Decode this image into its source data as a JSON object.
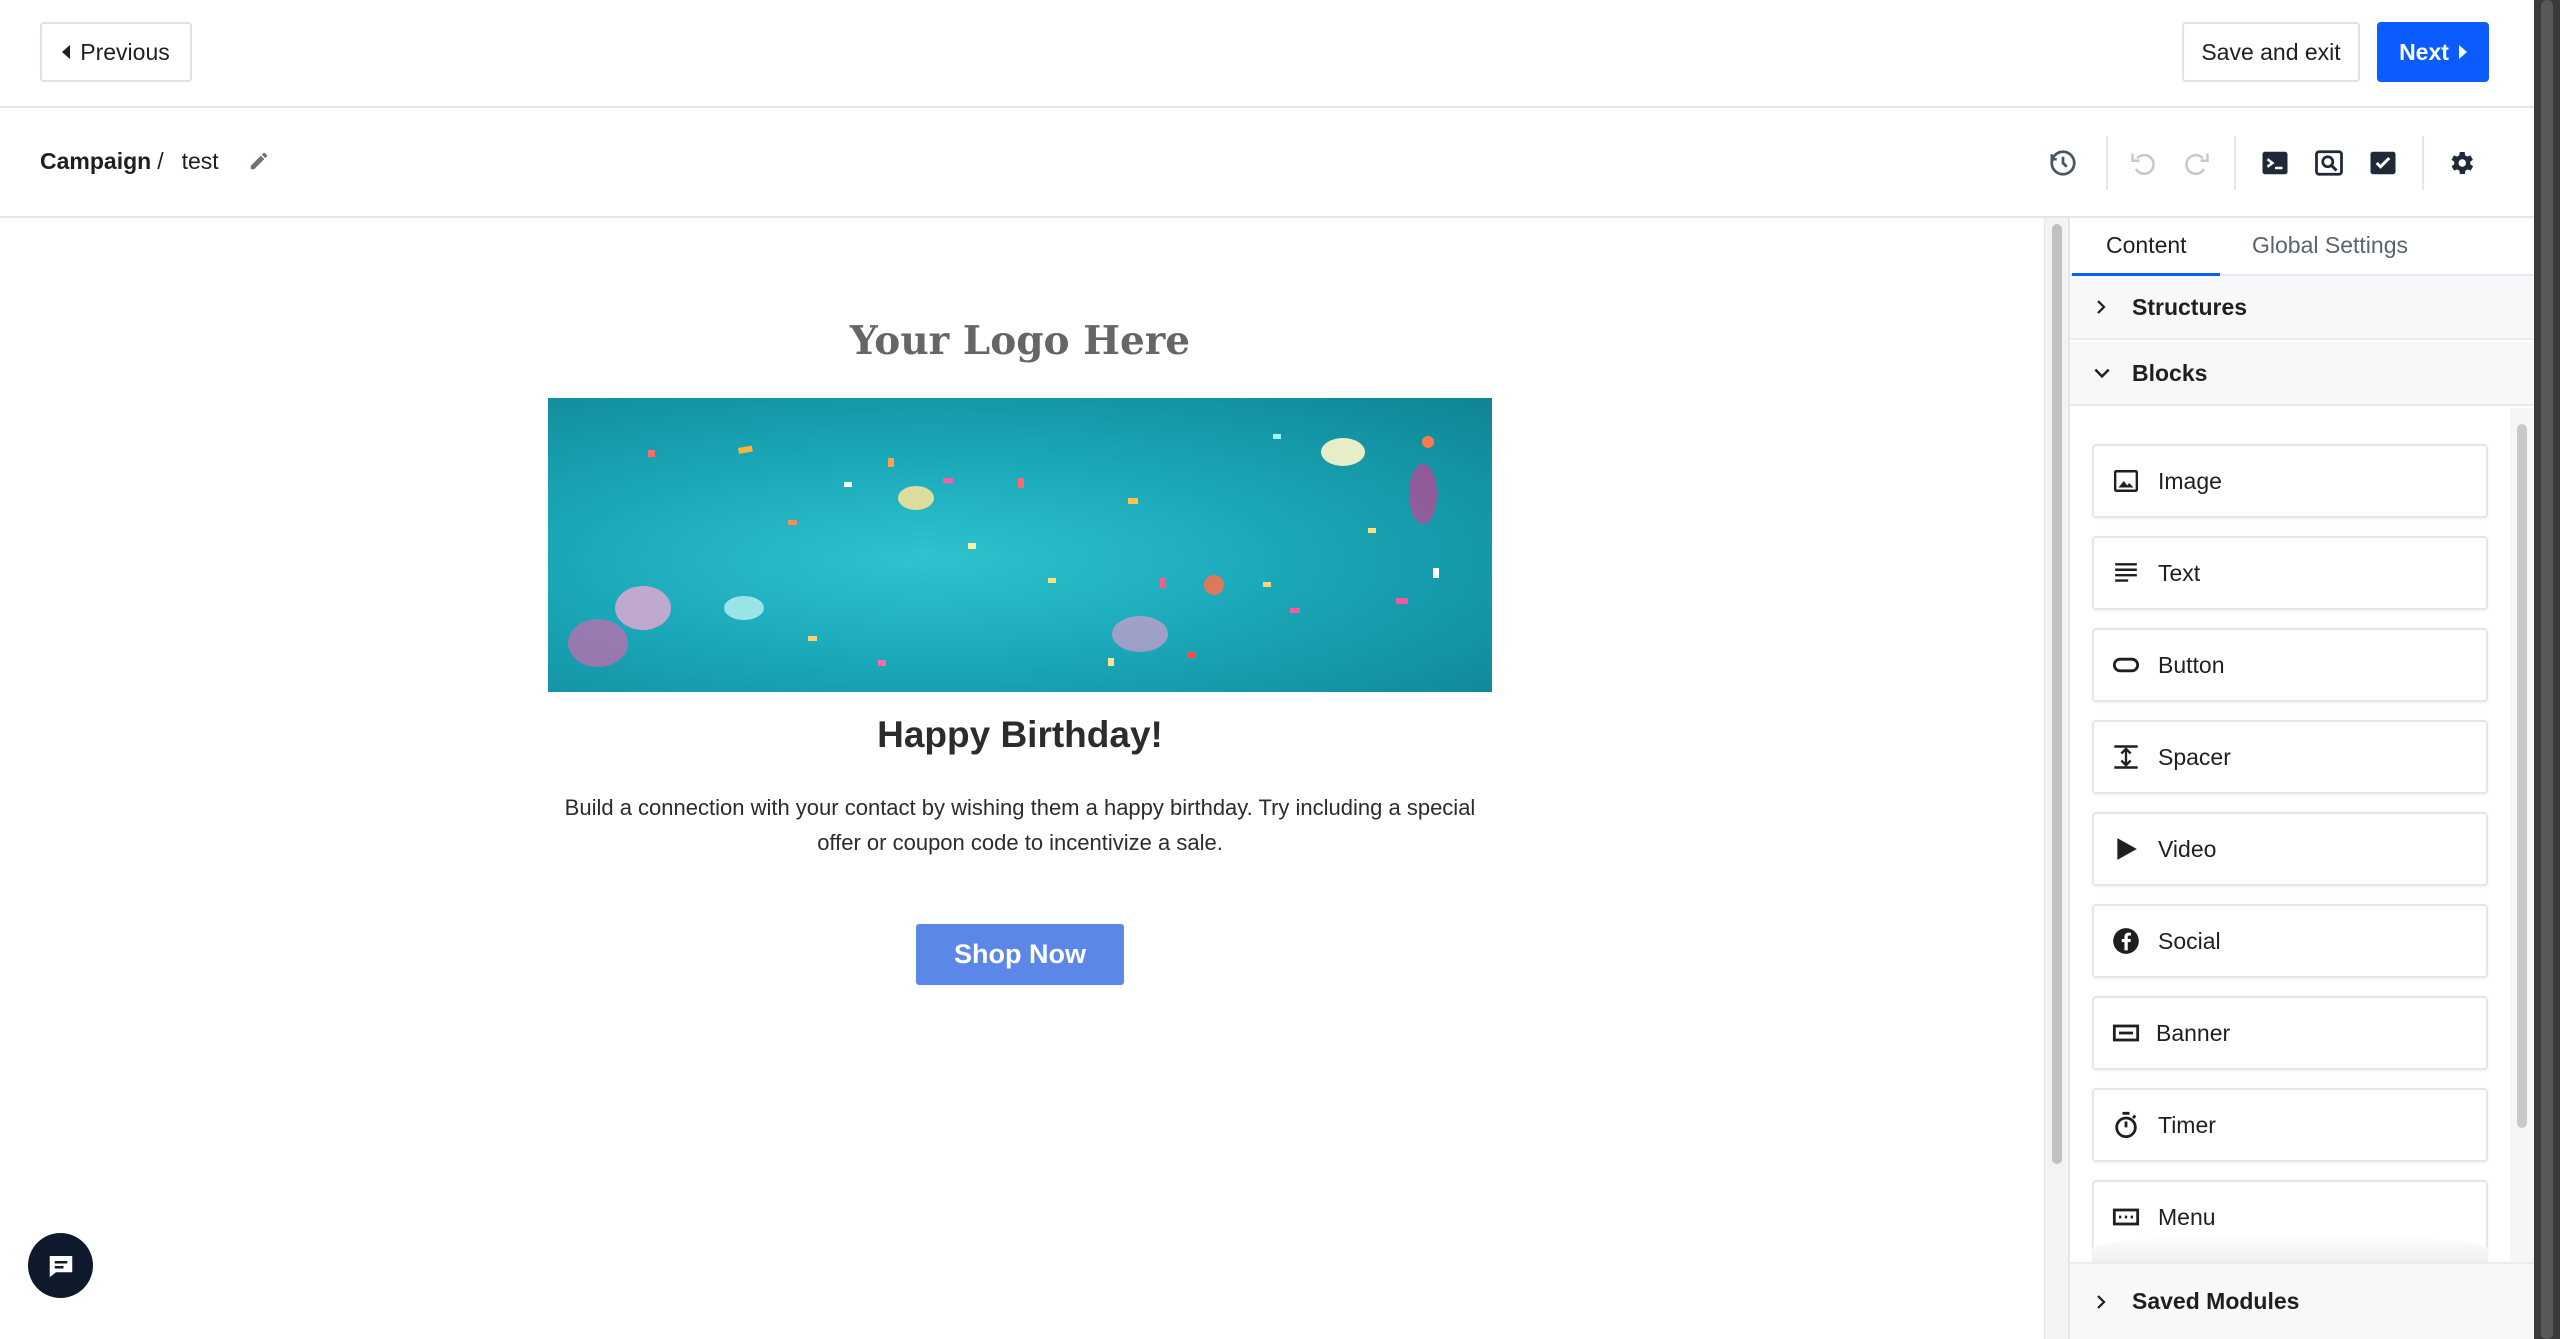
{
  "topbar": {
    "previous_label": "Previous",
    "save_exit_label": "Save and exit",
    "next_label": "Next"
  },
  "toolbar": {
    "breadcrumb_root": "Campaign",
    "breadcrumb_sep": "/",
    "campaign_name": "test",
    "icons": [
      "history-icon",
      "undo-icon",
      "redo-icon",
      "code-icon",
      "preview-icon",
      "checklist-icon",
      "settings-icon"
    ]
  },
  "email": {
    "logo_text": "Your Logo Here",
    "headline": "Happy Birthday!",
    "body_line1": "Build a connection with your contact by wishing them a happy birthday. Try including a special",
    "body_line2": "offer or coupon code to incentivize a sale.",
    "button_label": "Shop Now",
    "button_color": "#5b87e8"
  },
  "panel": {
    "tabs": [
      {
        "label": "Content",
        "active": true
      },
      {
        "label": "Global Settings",
        "active": false
      }
    ],
    "structures_label": "Structures",
    "blocks_label": "Blocks",
    "blocks": [
      {
        "label": "Image",
        "icon": "image-icon"
      },
      {
        "label": "Text",
        "icon": "text-icon"
      },
      {
        "label": "Button",
        "icon": "button-icon"
      },
      {
        "label": "Spacer",
        "icon": "spacer-icon"
      },
      {
        "label": "Video",
        "icon": "video-icon"
      },
      {
        "label": "Social",
        "icon": "facebook-icon"
      },
      {
        "label": "Banner",
        "icon": "banner-icon"
      },
      {
        "label": "Timer",
        "icon": "timer-icon"
      },
      {
        "label": "Menu",
        "icon": "menu-icon"
      }
    ],
    "saved_modules_label": "Saved Modules"
  },
  "colors": {
    "accent": "#0b5cff",
    "hero_teal": "#1aa8b8",
    "chat_bubble": "#0e1a2b"
  }
}
